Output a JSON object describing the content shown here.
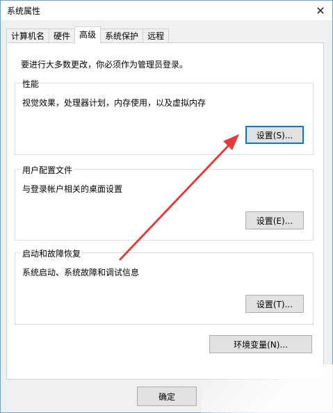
{
  "window": {
    "title": "系统属性"
  },
  "tabs": [
    {
      "label": "计算机名"
    },
    {
      "label": "硬件"
    },
    {
      "label": "高级"
    },
    {
      "label": "系统保护"
    },
    {
      "label": "远程"
    }
  ],
  "panel": {
    "intro": "要进行大多数更改，你必须作为管理员登录。",
    "performance": {
      "title": "性能",
      "description": "视觉效果，处理器计划，内存使用，以及虚拟内存",
      "button": "设置(S)..."
    },
    "user_profiles": {
      "title": "用户配置文件",
      "description": "与登录帐户相关的桌面设置",
      "button": "设置(E)..."
    },
    "startup_recovery": {
      "title": "启动和故障恢复",
      "description": "系统启动、系统故障和调试信息",
      "button": "设置(T)..."
    },
    "env_button": "环境变量(N)..."
  },
  "footer": {
    "ok_label": "确定"
  },
  "colors": {
    "accent": "#0078d7",
    "annotation_arrow": "#e03c3c"
  }
}
